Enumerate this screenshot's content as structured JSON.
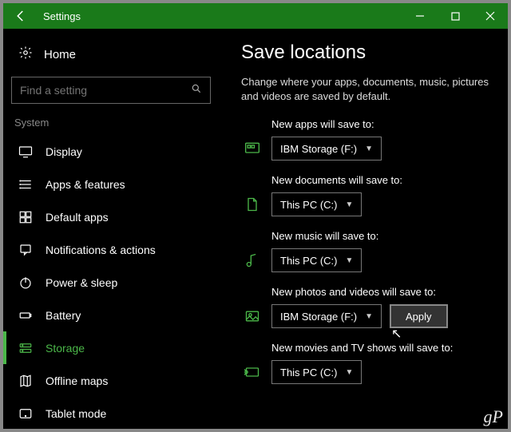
{
  "window": {
    "title": "Settings"
  },
  "sidebar": {
    "home_label": "Home",
    "search_placeholder": "Find a setting",
    "section": "System",
    "items": [
      {
        "label": "Display",
        "icon": "display"
      },
      {
        "label": "Apps & features",
        "icon": "apps"
      },
      {
        "label": "Default apps",
        "icon": "defaultapps"
      },
      {
        "label": "Notifications & actions",
        "icon": "notifications"
      },
      {
        "label": "Power & sleep",
        "icon": "power"
      },
      {
        "label": "Battery",
        "icon": "battery"
      },
      {
        "label": "Storage",
        "icon": "storage",
        "active": true
      },
      {
        "label": "Offline maps",
        "icon": "maps"
      },
      {
        "label": "Tablet mode",
        "icon": "tablet"
      }
    ]
  },
  "main": {
    "heading": "Save locations",
    "description": "Change where your apps, documents, music, pictures and videos are saved by default.",
    "settings": [
      {
        "label": "New apps will save to:",
        "value": "IBM Storage (F:)",
        "icon": "apps"
      },
      {
        "label": "New documents will save to:",
        "value": "This PC (C:)",
        "icon": "documents"
      },
      {
        "label": "New music will save to:",
        "value": "This PC (C:)",
        "icon": "music"
      },
      {
        "label": "New photos and videos will save to:",
        "value": "IBM Storage (F:)",
        "icon": "photos",
        "apply": true
      },
      {
        "label": "New movies and TV shows will save to:",
        "value": "This PC (C:)",
        "icon": "movies"
      }
    ],
    "apply_label": "Apply"
  },
  "watermark": "gP"
}
